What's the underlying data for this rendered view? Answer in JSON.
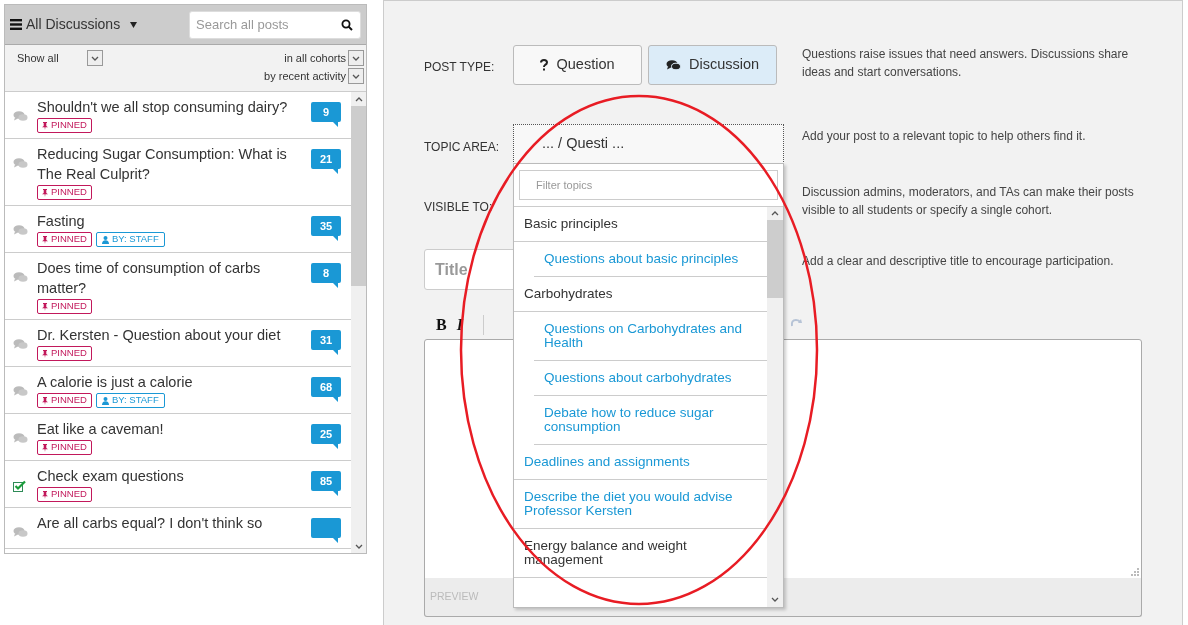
{
  "sidebar": {
    "menu_title": "All Discussions",
    "search_placeholder": "Search all posts",
    "filters": [
      {
        "label": "Show all"
      },
      {
        "label": "in all cohorts"
      },
      {
        "label": "by recent activity"
      }
    ],
    "posts": [
      {
        "kind": "discussion",
        "title": "Shouldn't we all stop consuming dairy?",
        "count": "9",
        "tags": [
          {
            "kind": "pinned",
            "label": "PINNED"
          }
        ]
      },
      {
        "kind": "discussion",
        "title": "Reducing Sugar Consumption: What is The Real Culprit?",
        "count": "21",
        "tags": [
          {
            "kind": "pinned",
            "label": "PINNED"
          }
        ]
      },
      {
        "kind": "discussion",
        "title": "Fasting",
        "count": "35",
        "tags": [
          {
            "kind": "pinned",
            "label": "PINNED"
          },
          {
            "kind": "staff",
            "label": "BY: STAFF"
          }
        ]
      },
      {
        "kind": "discussion",
        "title": "Does time of consumption of carbs matter?",
        "count": "8",
        "tags": [
          {
            "kind": "pinned",
            "label": "PINNED"
          }
        ]
      },
      {
        "kind": "discussion",
        "title": "Dr. Kersten - Question about your diet",
        "count": "31",
        "tags": [
          {
            "kind": "pinned",
            "label": "PINNED"
          }
        ]
      },
      {
        "kind": "discussion",
        "title": "A calorie is just a calorie",
        "count": "68",
        "tags": [
          {
            "kind": "pinned",
            "label": "PINNED"
          },
          {
            "kind": "staff",
            "label": "BY: STAFF"
          }
        ]
      },
      {
        "kind": "discussion",
        "title": "Eat like a caveman!",
        "count": "25",
        "tags": [
          {
            "kind": "pinned",
            "label": "PINNED"
          }
        ]
      },
      {
        "kind": "answered",
        "title": "Check exam questions",
        "count": "85",
        "tags": [
          {
            "kind": "pinned",
            "label": "PINNED"
          }
        ]
      },
      {
        "kind": "discussion",
        "title": "Are all carbs equal? I don't think so"
      }
    ]
  },
  "form": {
    "post_type": {
      "label": "POST TYPE:",
      "options": [
        {
          "kind": "question",
          "label": "Question",
          "selected": false
        },
        {
          "kind": "discussion",
          "label": "Discussion",
          "selected": true
        }
      ],
      "description": "Questions raise issues that need answers. Discussions share ideas and start conversations."
    },
    "topic_area": {
      "label": "TOPIC AREA:",
      "value": "... / Questi ...",
      "description": "Add your post to a relevant topic to help others find it."
    },
    "visible_to": {
      "label": "VISIBLE TO:",
      "description": "Discussion admins, moderators, and TAs can make their posts visible to all students or specify a single cohort."
    },
    "title": {
      "placeholder": "Title",
      "description": "Add a clear and descriptive title to encourage participation."
    },
    "toolbar": [
      {
        "kind": "bold",
        "label": "B"
      },
      {
        "kind": "italic",
        "label": "I"
      }
    ],
    "preview_label": "PREVIEW"
  },
  "topic_menu": {
    "filter_placeholder": "Filter topics",
    "items": [
      {
        "label": "Basic principles",
        "children": [
          {
            "label": "Questions about basic principles"
          }
        ]
      },
      {
        "label": "Carbohydrates",
        "children": [
          {
            "label": "Questions on Carbohydrates and Health"
          },
          {
            "label": "Questions about carbohydrates"
          },
          {
            "label": "Debate how to reduce sugar consumption"
          }
        ]
      },
      {
        "label": "Deadlines and assignments"
      },
      {
        "label": "Describe the diet you would advise Professor Kersten"
      },
      {
        "label": "Energy balance and weight management",
        "children": [
          {
            "kind": "cut"
          }
        ]
      }
    ]
  }
}
